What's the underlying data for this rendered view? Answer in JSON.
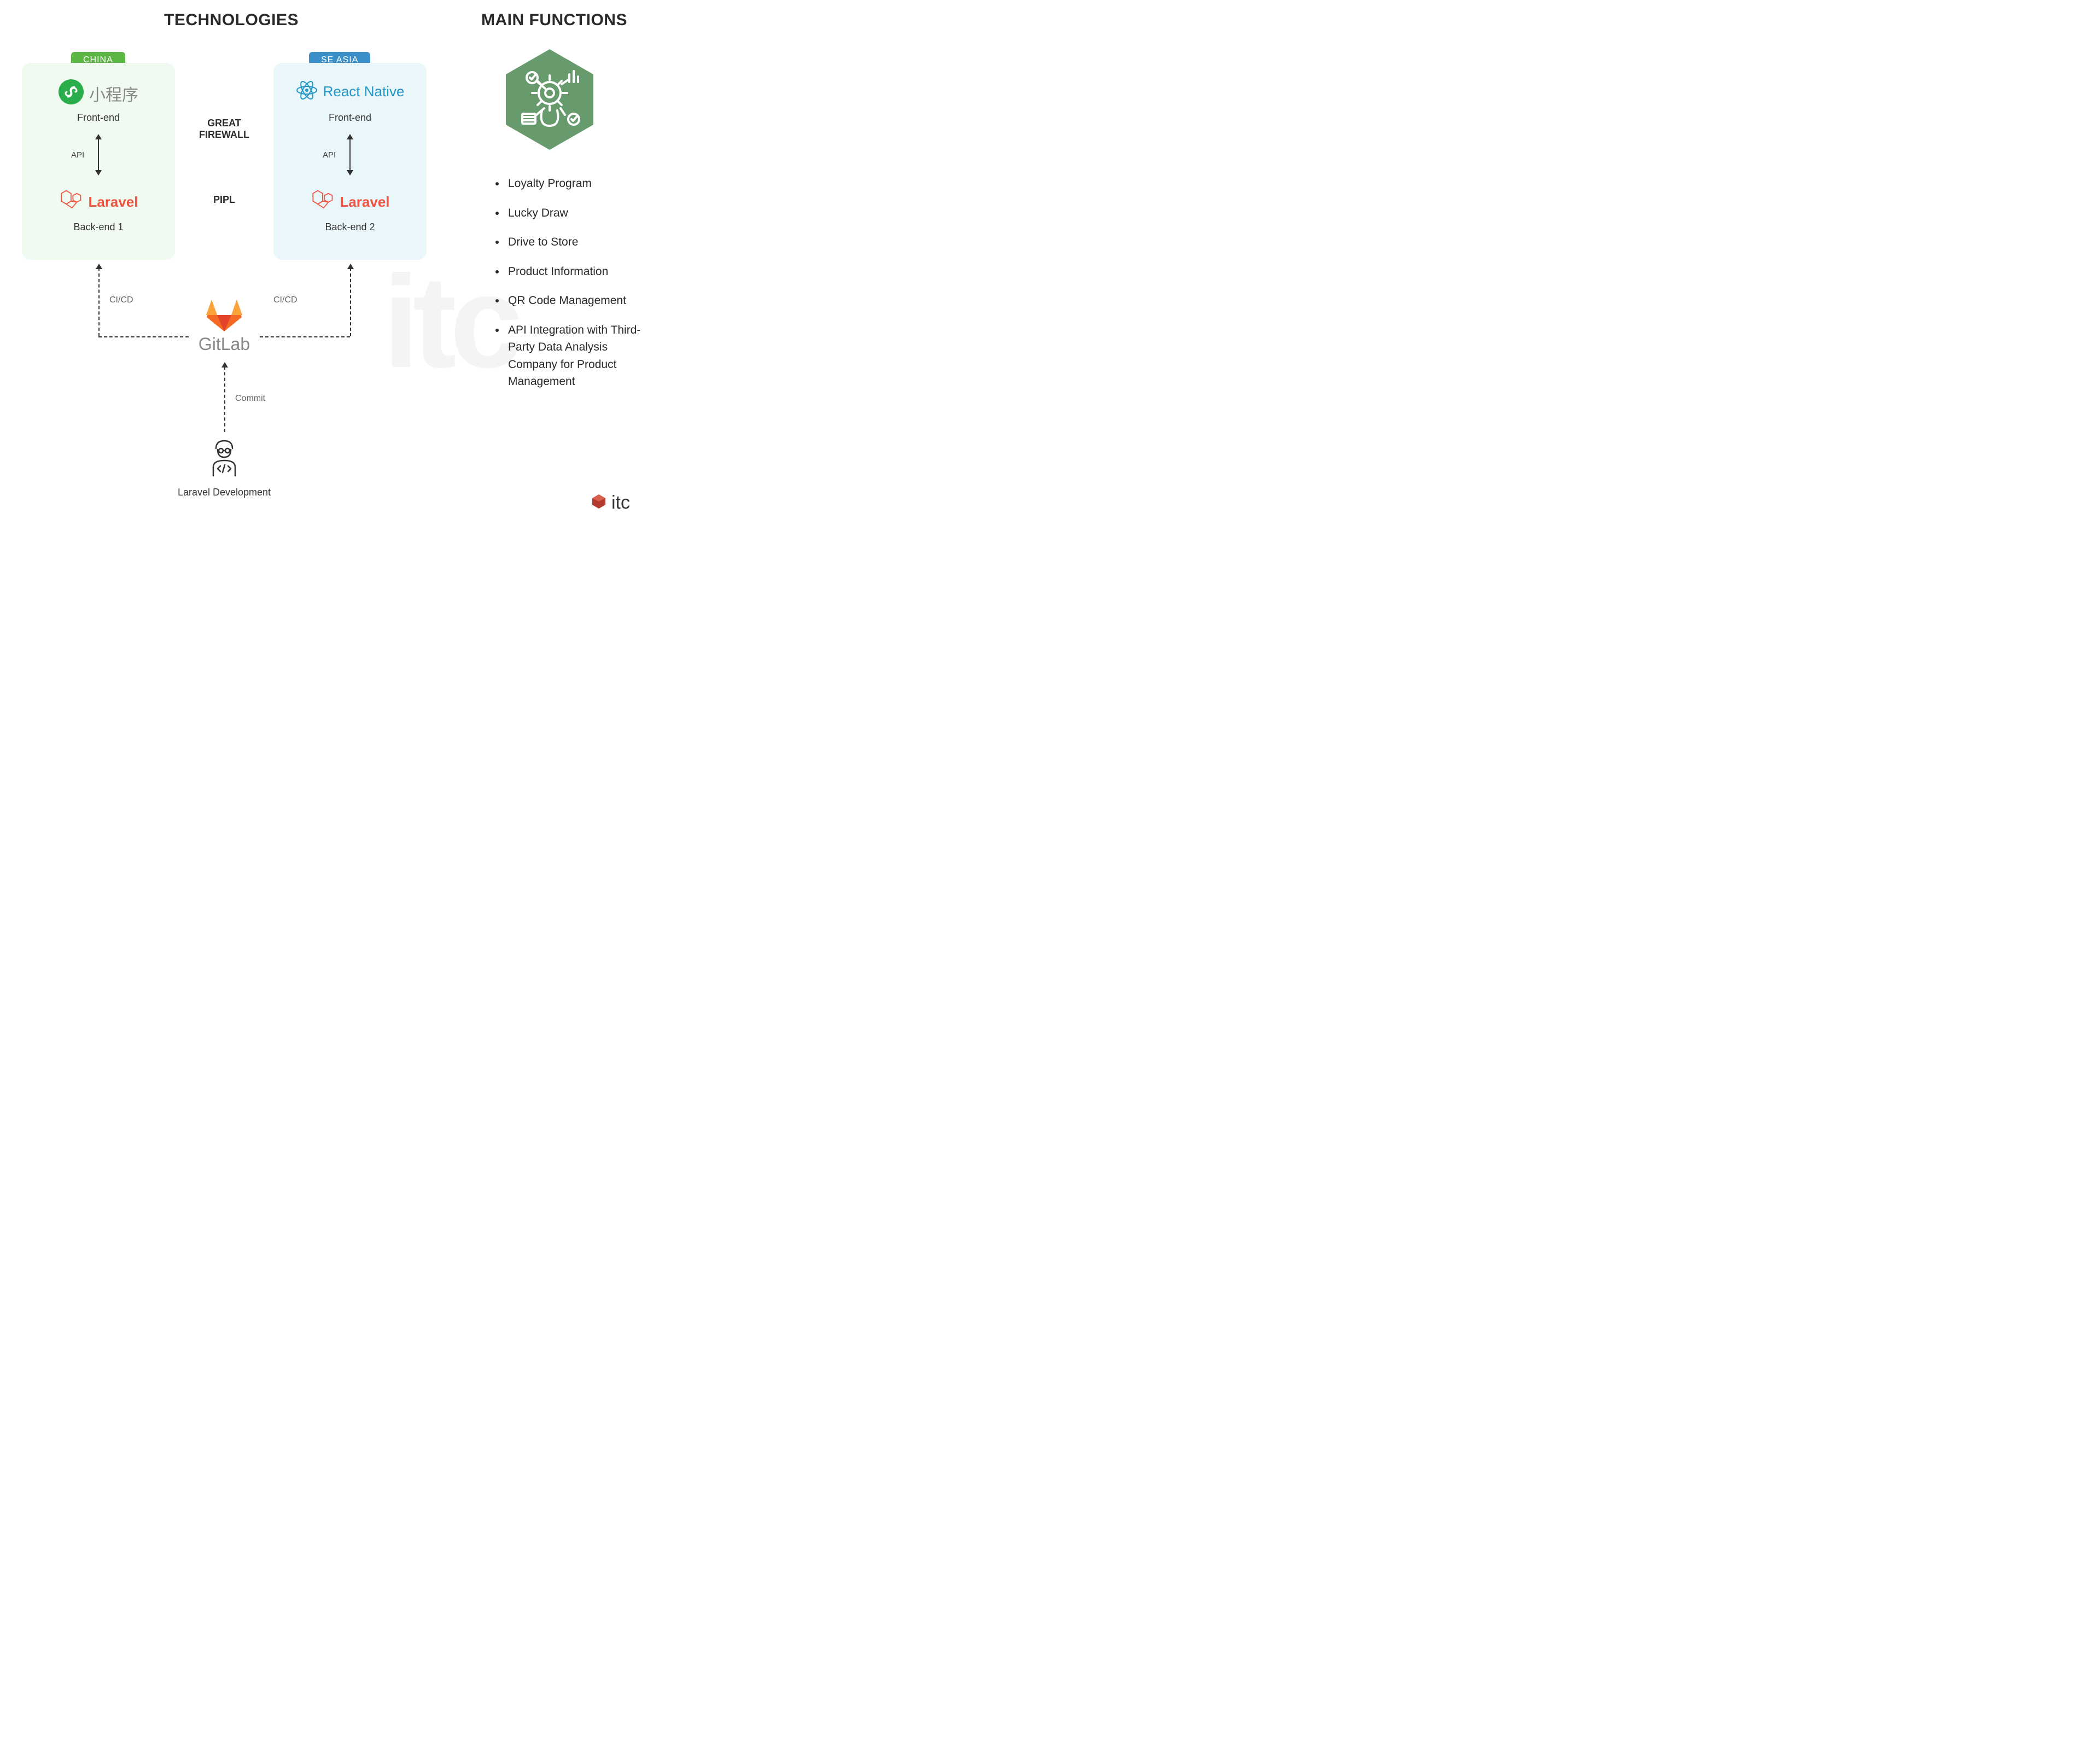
{
  "headings": {
    "technologies": "TECHNOLOGIES",
    "main_functions": "MAIN FUNCTIONS"
  },
  "badges": {
    "china": "CHINA",
    "seasia": "SE ASIA"
  },
  "china_box": {
    "frontend_name": "小程序",
    "frontend_label": "Front-end",
    "api_label": "API",
    "backend_name": "Laravel",
    "backend_label": "Back-end 1"
  },
  "seasia_box": {
    "frontend_name": "React Native",
    "frontend_label": "Front-end",
    "api_label": "API",
    "backend_name": "Laravel",
    "backend_label": "Back-end 2"
  },
  "middle": {
    "firewall": "GREAT FIREWALL",
    "pipl": "PIPL"
  },
  "pipeline": {
    "cicd_left": "CI/CD",
    "cicd_right": "CI/CD",
    "gitlab": "GitLab",
    "commit": "Commit",
    "dev_label": "Laravel Development"
  },
  "functions_list": [
    "Loyalty Program",
    "Lucky Draw",
    "Drive to Store",
    "Product Information",
    "QR Code Management",
    "API Integration with Third-Party Data Analysis Company for Product Management"
  ],
  "brand": {
    "itc": "itc",
    "watermark": "itc"
  },
  "colors": {
    "badge_green": "#5cb644",
    "badge_blue": "#3a8fc8",
    "box_green": "#f1faf1",
    "box_blue": "#e9f6fa",
    "laravel": "#f05340",
    "react": "#2196c9",
    "hex": "#679a6c"
  }
}
